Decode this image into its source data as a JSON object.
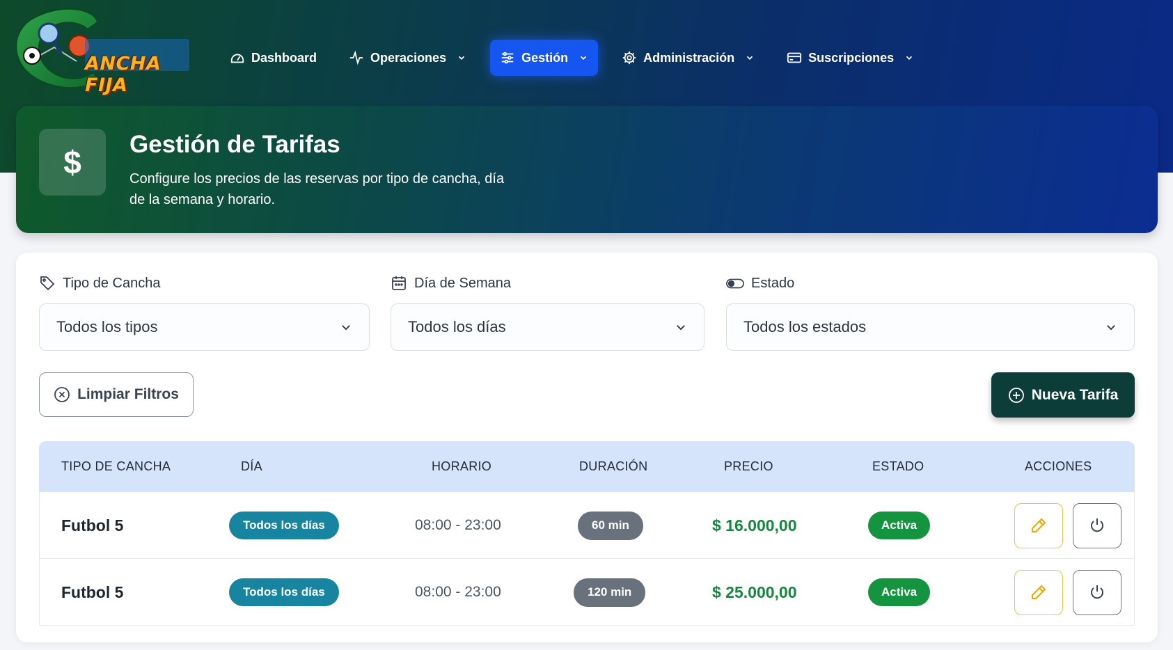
{
  "logo": {
    "text": "ANCHA FIJA",
    "icon": "sports-logo-icon"
  },
  "nav": {
    "items": [
      {
        "label": "Dashboard",
        "icon": "dashboard-icon",
        "dropdown": false,
        "active": false
      },
      {
        "label": "Operaciones",
        "icon": "activity-icon",
        "dropdown": true,
        "active": false
      },
      {
        "label": "Gestión",
        "icon": "sliders-icon",
        "dropdown": true,
        "active": true
      },
      {
        "label": "Administración",
        "icon": "gear-icon",
        "dropdown": true,
        "active": false
      },
      {
        "label": "Suscripciones",
        "icon": "credit-card-icon",
        "dropdown": true,
        "active": false
      }
    ]
  },
  "hero": {
    "icon_symbol": "$",
    "title": "Gestión de Tarifas",
    "description": "Configure los precios de las reservas por tipo de cancha, día de la semana y horario."
  },
  "filters": {
    "court_type": {
      "label": "Tipo de Cancha",
      "value": "Todos los tipos",
      "icon": "tag-icon"
    },
    "weekday": {
      "label": "Día de Semana",
      "value": "Todos los días",
      "icon": "calendar-icon"
    },
    "status": {
      "label": "Estado",
      "value": "Todos los estados",
      "icon": "toggle-icon"
    }
  },
  "buttons": {
    "clear_filters": "Limpiar Filtros",
    "new_rate": "Nueva Tarifa"
  },
  "table": {
    "headers": [
      "TIPO DE CANCHA",
      "DÍA",
      "HORARIO",
      "DURACIÓN",
      "PRECIO",
      "ESTADO",
      "ACCIONES"
    ],
    "rows": [
      {
        "court": "Futbol 5",
        "day": "Todos los días",
        "schedule": "08:00 - 23:00",
        "duration": "60 min",
        "price": "$ 16.000,00",
        "status": "Activa"
      },
      {
        "court": "Futbol 5",
        "day": "Todos los días",
        "schedule": "08:00 - 23:00",
        "duration": "120 min",
        "price": "$ 25.000,00",
        "status": "Activa"
      }
    ]
  },
  "colors": {
    "active_nav": "#1555f0",
    "primary_dark": "#0c3d38",
    "day_pill": "#1785a0",
    "duration_pill": "#69717d",
    "status_active": "#15943f",
    "price": "#16873f",
    "table_header": "#d6e4fb"
  }
}
